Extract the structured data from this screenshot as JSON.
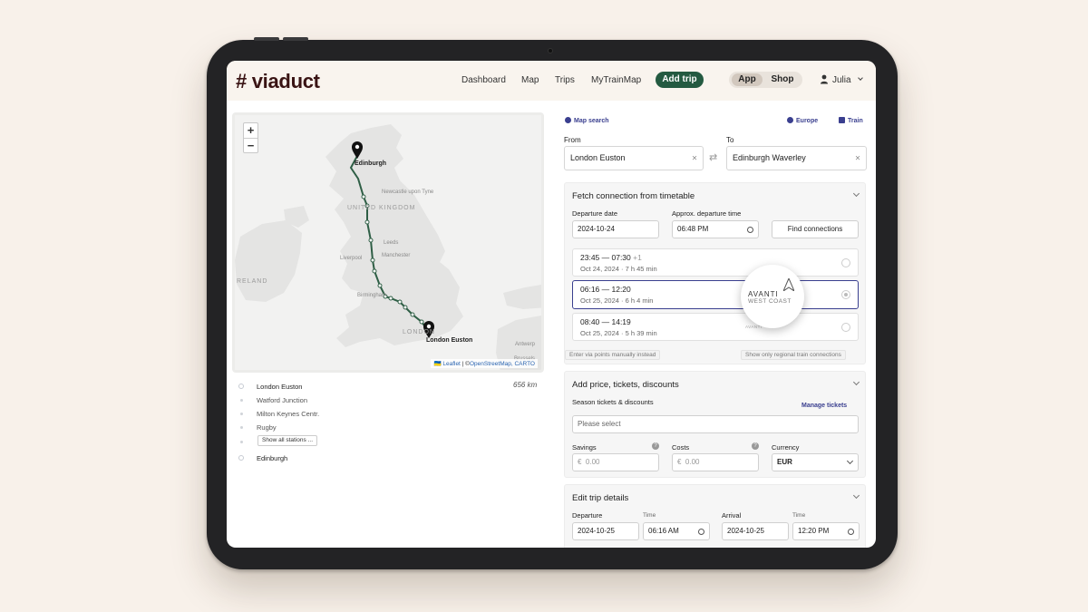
{
  "app": {
    "logo": "# viaduct"
  },
  "nav": [
    "Dashboard",
    "Map",
    "Trips",
    "MyTrainMap"
  ],
  "add_trip": "Add trip",
  "toggle": {
    "app": "App",
    "shop": "Shop"
  },
  "user": {
    "name": "Julia"
  },
  "map": {
    "zoom_in": "+",
    "zoom_out": "−",
    "labels": {
      "edinburgh": "Edinburgh",
      "london_euston": "London Euston",
      "united_kingdom": "UNITED KINGDOM",
      "ireland": "RELAND",
      "london": "LONDON",
      "leeds": "Leeds",
      "manchester": "Manchester",
      "liverpool": "Liverpool",
      "birmingham": "Birmingham",
      "newcastle": "Newcastle upon Tyne",
      "antwerp": "Antwerp",
      "brussels": "Brussels"
    },
    "attribution": {
      "flag": "🇺🇦",
      "leaflet": "Leaflet",
      "sep": " | ©",
      "osm": "OpenStreetMap",
      "carto": ", CARTO"
    }
  },
  "stations": {
    "distance": "656 km",
    "items": [
      "London Euston",
      "Watford Junction",
      "Milton Keynes Centr.",
      "Rugby"
    ],
    "show_all": "Show all stations ...",
    "last": "Edinburgh"
  },
  "search": {
    "map_search": "Map search",
    "region": "Europe",
    "mode": "Train",
    "from_label": "From",
    "to_label": "To",
    "from_value": "London Euston",
    "to_value": "Edinburgh Waverley",
    "clear": "×",
    "swap": "⇄"
  },
  "timetable": {
    "title": "Fetch connection from timetable",
    "departure_date_label": "Departure date",
    "departure_date": "2024-10-24",
    "approx_time_label": "Approx. departure time",
    "approx_time": "06:48  PM",
    "find_button": "Find connections",
    "connections": [
      {
        "time": "23:45 — 07:30",
        "plus": "+1",
        "meta": "Oct 24, 2024  ·  7 h 45 min"
      },
      {
        "time": "06:16 — 12:20",
        "plus": "",
        "meta": "Oct 25, 2024  ·  6 h 4 min"
      },
      {
        "time": "08:40 — 14:19",
        "plus": "",
        "meta": "Oct 25, 2024  ·  5 h 39 min"
      }
    ],
    "operator_top": "AVANTI",
    "operator_bottom": "WEST COAST",
    "via_manual": "Enter via points manually instead",
    "regional_only": "Show only regional train connections"
  },
  "pricing": {
    "title": "Add price, tickets, discounts",
    "season_label": "Season tickets & discounts",
    "manage_tickets": "Manage tickets",
    "placeholder": "Please select",
    "savings_label": "Savings",
    "costs_label": "Costs",
    "currency_label": "Currency",
    "currency_symbol": "€",
    "savings_value": "0.00",
    "costs_value": "0.00",
    "currency": "EUR",
    "help": "?"
  },
  "trip_details": {
    "title": "Edit trip details",
    "departure_label": "Departure",
    "arrival_label": "Arrival",
    "time_label": "Time",
    "departure_date": "2024-10-25",
    "departure_time": "06:16  AM",
    "arrival_date": "2024-10-25",
    "arrival_time": "12:20  PM"
  },
  "colors": {
    "route": "#2e5e45",
    "brand": "#3a1414",
    "accent": "#3a3f8f",
    "add_trip_bg": "#245a41"
  }
}
